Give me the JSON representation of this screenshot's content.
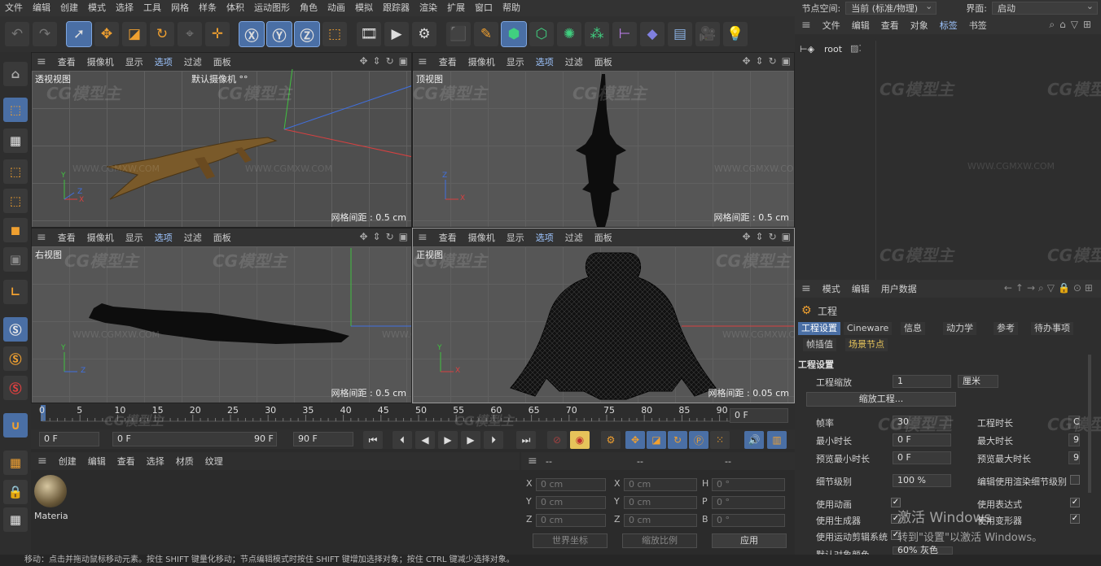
{
  "menubar": {
    "items": [
      "文件",
      "编辑",
      "创建",
      "模式",
      "选择",
      "工具",
      "网格",
      "样条",
      "体积",
      "运动图形",
      "角色",
      "动画",
      "模拟",
      "跟踪器",
      "渲染",
      "扩展",
      "窗口",
      "帮助"
    ],
    "node_space_label": "节点空间:",
    "node_space_value": "当前 (标准/物理)",
    "layout_label": "界面:",
    "layout_value": "启动"
  },
  "icons": {
    "toolbar": [
      "undo-icon",
      "redo-icon",
      "select-arrow-icon",
      "move-icon",
      "scale-icon",
      "rotate-icon",
      "recent-tool-icon",
      "world-axis-icon",
      "x-axis-icon",
      "y-axis-icon",
      "z-axis-icon",
      "coordinate-system-icon",
      "render-region-icon",
      "render-view-icon",
      "render-settings-icon",
      "cube-icon",
      "pen-icon",
      "sculpt-icon",
      "subdivision-icon",
      "mograph-icon",
      "cloner-icon",
      "deformer-icon",
      "environment-icon",
      "floor-icon",
      "camera-icon",
      "light-icon"
    ],
    "left": [
      "make-editable-icon",
      "model-mode-icon",
      "texture-mode-icon",
      "points-mode-icon",
      "edges-mode-icon",
      "polygons-mode-icon",
      "uv-mode-icon",
      "axis-mode-icon",
      "snap-s-icon",
      "snap-s-orange-icon",
      "snap-s-red-icon",
      "magnet-icon",
      "grid-plane-icon",
      "lock-icon",
      "workplane-icon"
    ]
  },
  "viewports": [
    {
      "title": "透视视图",
      "camera": "默认摄像机 °°",
      "grid": "网格间距 : 0.5 cm",
      "menu": [
        "查看",
        "摄像机",
        "显示",
        "选项",
        "过滤",
        "面板"
      ]
    },
    {
      "title": "顶视图",
      "camera": "",
      "grid": "网格间距 : 0.5 cm",
      "menu": [
        "查看",
        "摄像机",
        "显示",
        "选项",
        "过滤",
        "面板"
      ]
    },
    {
      "title": "右视图",
      "camera": "",
      "grid": "网格间距 : 0.5 cm",
      "menu": [
        "查看",
        "摄像机",
        "显示",
        "选项",
        "过滤",
        "面板"
      ]
    },
    {
      "title": "正视图",
      "camera": "",
      "grid": "网格间距 : 0.05 cm",
      "menu": [
        "查看",
        "摄像机",
        "显示",
        "选项",
        "过滤",
        "面板"
      ]
    }
  ],
  "axis_labels": {
    "x": "X",
    "y": "Y",
    "z": "Z"
  },
  "watermark": {
    "logo": "CG模型主",
    "url": "WWW.CGMXW.COM"
  },
  "timeline": {
    "ticks": [
      "0",
      "5",
      "10",
      "15",
      "20",
      "25",
      "30",
      "35",
      "40",
      "45",
      "50",
      "55",
      "60",
      "65",
      "70",
      "75",
      "80",
      "85",
      "90"
    ],
    "current_frame": "0 F",
    "start": "0 F",
    "range_start": "0 F",
    "range_end": "90 F",
    "end": "90 F"
  },
  "material_manager": {
    "menu": [
      "创建",
      "编辑",
      "查看",
      "选择",
      "材质",
      "纹理"
    ],
    "material_name": "Materia"
  },
  "coordinates": {
    "header": [
      "--",
      "--",
      "--"
    ],
    "rows": [
      {
        "a": "X",
        "av": "0 cm",
        "b": "X",
        "bv": "0 cm",
        "c": "H",
        "cv": "0 °"
      },
      {
        "a": "Y",
        "av": "0 cm",
        "b": "Y",
        "bv": "0 cm",
        "c": "P",
        "cv": "0 °"
      },
      {
        "a": "Z",
        "av": "0 cm",
        "b": "Z",
        "bv": "0 cm",
        "c": "B",
        "cv": "0 °"
      }
    ],
    "world": "世界坐标",
    "scale": "缩放比例",
    "apply": "应用"
  },
  "object_manager": {
    "menu": [
      "文件",
      "编辑",
      "查看",
      "对象",
      "标签",
      "书签"
    ],
    "root": "root"
  },
  "attributes": {
    "menu": [
      "模式",
      "编辑",
      "用户数据"
    ],
    "title": "工程",
    "tabs_row1": [
      "工程设置",
      "Cineware",
      "信息",
      "动力学",
      "参考",
      "待办事项"
    ],
    "tabs_row2": [
      "帧插值",
      "场景节点"
    ],
    "section": "工程设置",
    "project_scale_label": "工程缩放",
    "project_scale_value": "1",
    "project_scale_unit": "厘米",
    "scale_project_button": "缩放工程...",
    "fps_label": "帧率",
    "fps_value": "30",
    "project_time_label": "工程时长",
    "project_time_value": "C",
    "min_time_label": "最小时长",
    "min_time_value": "0 F",
    "max_time_label": "最大时长",
    "max_time_value": "9",
    "preview_min_label": "预览最小时长",
    "preview_min_value": "0 F",
    "preview_max_label": "预览最大时长",
    "preview_max_value": "9",
    "lod_label": "细节级别",
    "lod_value": "100 %",
    "render_lod_label": "编辑使用渲染细节级别",
    "use_animation_label": "使用动画",
    "use_expressions_label": "使用表达式",
    "use_generators_label": "使用生成器",
    "use_deformers_label": "使用变形器",
    "use_motion_label": "使用运动剪辑系统",
    "default_color_label": "默认对象颜色",
    "default_color_value": "60% 灰色",
    "activate_line1": "激活 Windows",
    "activate_line2": "转到\"设置\"以激活 Windows。"
  },
  "status": "移动：点击并拖动鼠标移动元素。按住 SHIFT 键量化移动；节点编辑模式时按住 SHIFT 键增加选择对象；按住 CTRL 键减少选择对象。",
  "colors": {
    "accent": "#4a6fa5",
    "x_axis": "#d84040",
    "y_axis": "#40c040",
    "z_axis": "#4070e0",
    "selection": "#ffaa00"
  }
}
